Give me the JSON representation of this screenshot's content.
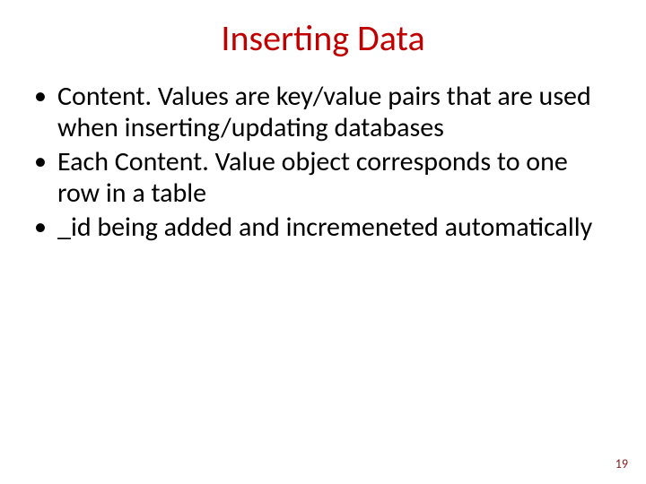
{
  "title": "Inserting Data",
  "bullets": [
    "Content. Values are key/value pairs that are used when inserting/updating databases",
    "Each Content. Value object corresponds to one row in a table",
    "_id being added and incremeneted automatically"
  ],
  "page_number": "19"
}
